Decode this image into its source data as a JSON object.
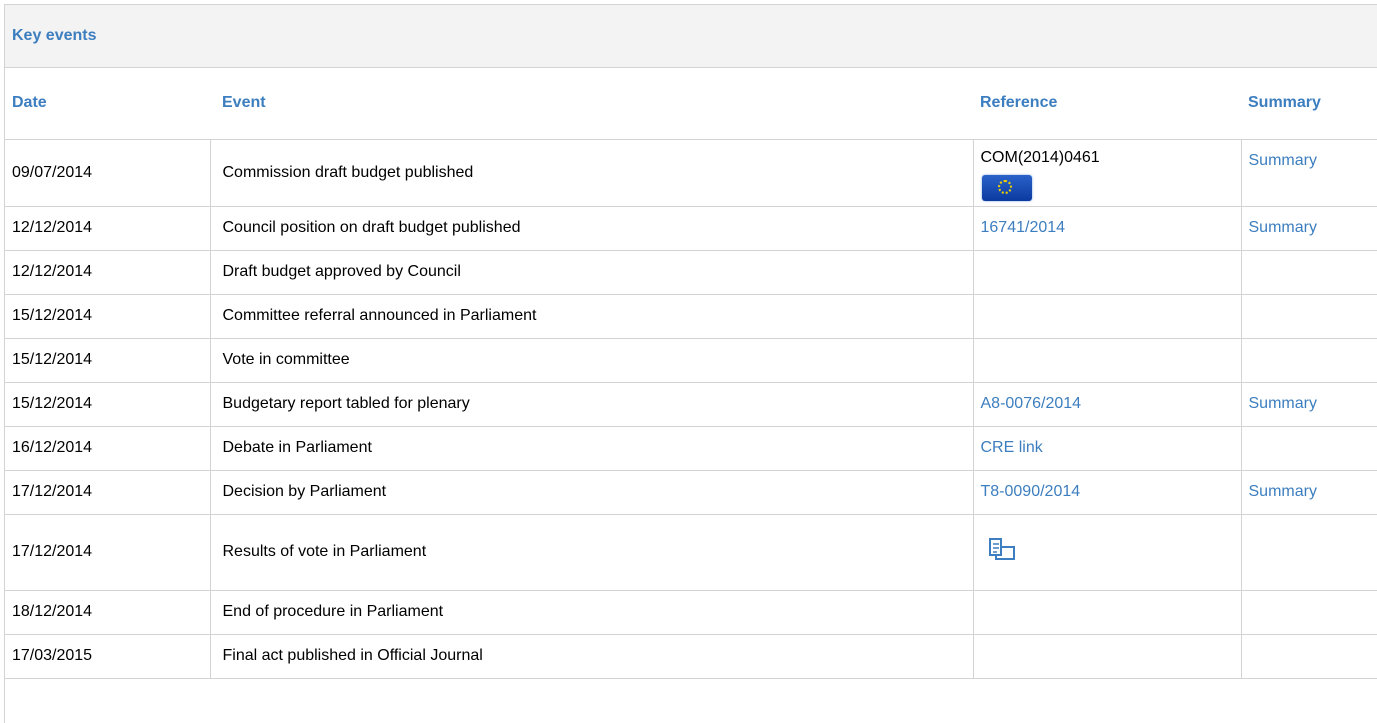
{
  "panel": {
    "title": "Key events"
  },
  "table": {
    "headers": {
      "date": "Date",
      "event": "Event",
      "reference": "Reference",
      "summary": "Summary"
    },
    "rows": [
      {
        "date": "09/07/2014",
        "event": "Commission draft budget published",
        "reference": "COM(2014)0461",
        "reference_icon": "eu-flag-icon",
        "summary": "Summary"
      },
      {
        "date": "12/12/2014",
        "event": "Council position on draft budget published",
        "reference": "16741/2014",
        "summary": "Summary"
      },
      {
        "date": "12/12/2014",
        "event": "Draft budget approved by Council",
        "reference": "",
        "summary": ""
      },
      {
        "date": "15/12/2014",
        "event": "Committee referral announced in Parliament",
        "reference": "",
        "summary": ""
      },
      {
        "date": "15/12/2014",
        "event": "Vote in committee",
        "reference": "",
        "summary": ""
      },
      {
        "date": "15/12/2014",
        "event": "Budgetary report tabled for plenary",
        "reference": "A8-0076/2014",
        "summary": "Summary"
      },
      {
        "date": "16/12/2014",
        "event": "Debate in Parliament",
        "reference": "CRE link",
        "summary": ""
      },
      {
        "date": "17/12/2014",
        "event": "Decision by Parliament",
        "reference": "T8-0090/2014",
        "summary": "Summary"
      },
      {
        "date": "17/12/2014",
        "event": "Results of vote in Parliament",
        "reference": "",
        "reference_icon": "vote-results-icon",
        "summary": ""
      },
      {
        "date": "18/12/2014",
        "event": "End of procedure in Parliament",
        "reference": "",
        "summary": ""
      },
      {
        "date": "17/03/2015",
        "event": "Final act published in Official Journal",
        "reference": "",
        "summary": ""
      }
    ]
  },
  "colors": {
    "accent": "#3c7ebf",
    "border": "#d3d3d3",
    "header_bg": "#f3f3f3"
  }
}
